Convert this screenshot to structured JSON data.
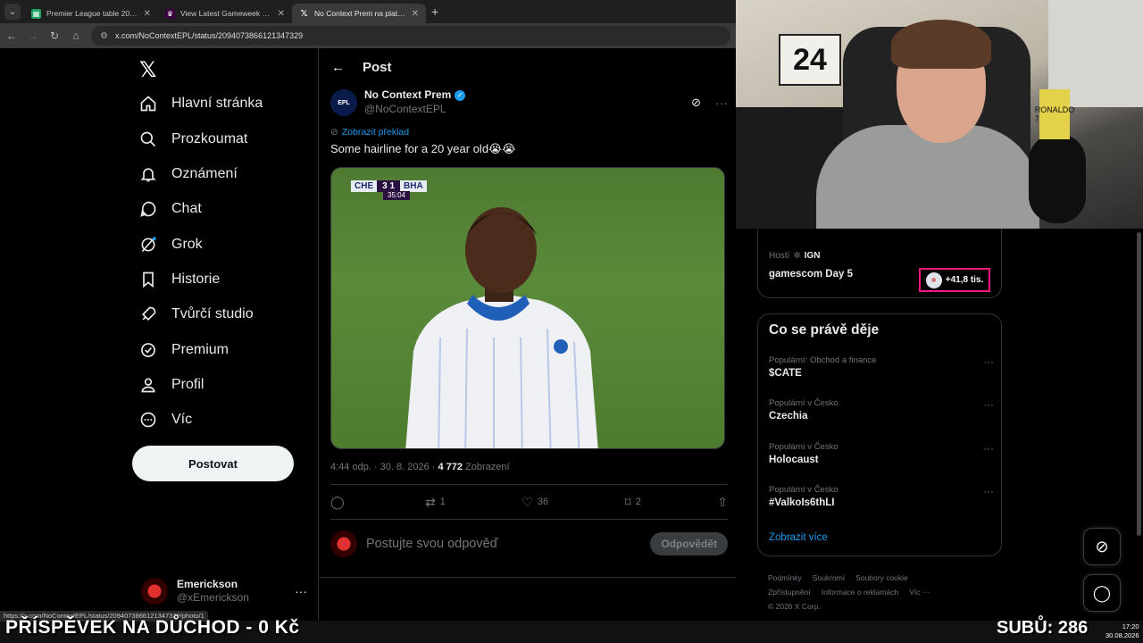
{
  "browser": {
    "tabs": [
      {
        "title": "Premier League table 2026/2027",
        "icon": "sheet-icon"
      },
      {
        "title": "View Latest Gameweek Points | Fantasy",
        "icon": "pl-icon"
      },
      {
        "title": "No Context Prem na platformě X",
        "icon": "x-icon"
      }
    ],
    "url": "x.com/NoContextEPL/status/2094073866121347329",
    "status_url": "https://x.com/NoContextEPL/status/2094073866121347329/photo/1"
  },
  "nav": {
    "items": [
      {
        "label": "Hlavní stránka",
        "icon": "home-icon"
      },
      {
        "label": "Prozkoumat",
        "icon": "search-icon"
      },
      {
        "label": "Oznámení",
        "icon": "bell-icon"
      },
      {
        "label": "Chat",
        "icon": "chat-icon"
      },
      {
        "label": "Grok",
        "icon": "grok-icon"
      },
      {
        "label": "Historie",
        "icon": "bookmark-icon"
      },
      {
        "label": "Tvůrčí studio",
        "icon": "rocket-icon"
      },
      {
        "label": "Premium",
        "icon": "premium-icon"
      },
      {
        "label": "Profil",
        "icon": "person-icon"
      },
      {
        "label": "Víc",
        "icon": "more-circle-icon"
      }
    ],
    "post_button": "Postovat",
    "account": {
      "display_name": "Emerickson",
      "handle": "@xEmerickson"
    }
  },
  "post": {
    "header_title": "Post",
    "author": {
      "display_name": "No Context Prem",
      "handle": "@NoContextEPL",
      "avatar_text": "EPL"
    },
    "translate_label": "Zobrazit překlad",
    "text": "Some hairline for a 20 year old😭😭",
    "media": {
      "home": "CHE",
      "score": "3 1",
      "away": "BHA",
      "clock": "35:04"
    },
    "time": "4:44 odp. · 30. 8. 2026 · ",
    "views_count": "4 772",
    "views_label": " Zobrazení",
    "actions": {
      "replies": "",
      "reposts": "1",
      "likes": "36",
      "bookmarks": "2"
    },
    "reply_placeholder": "Postujte svou odpověď",
    "reply_button": "Odpovědět"
  },
  "sidebar": {
    "live": {
      "host_label": "Hostí",
      "host_name": "IGN",
      "event": "gamescom Day 5",
      "listeners": "+41,8 tis."
    },
    "trends_title": "Co se právě děje",
    "trends": [
      {
        "category": "Populární: Obchod a finance",
        "name": "$CATE"
      },
      {
        "category": "Populární v Česko",
        "name": "Czechia"
      },
      {
        "category": "Populární v Česko",
        "name": "Holocaust"
      },
      {
        "category": "Populární v Česko",
        "name": "#ValkoIs6thLI"
      }
    ],
    "show_more": "Zobrazit více",
    "footer": [
      "Podmínky",
      "Soukromí",
      "Soubory cookie",
      "Zpřístupnění",
      "Informace o reklamách",
      "Víc ···",
      "© 2026 X Corp."
    ]
  },
  "overlay": {
    "banner": "PŘÍSPĚVEK NA DŮCHOD -  0 Kč",
    "subs": "SUBŮ: 286",
    "time": "17:20",
    "date": "30.08.2026",
    "jersey": "RONALDO 7",
    "frame_number": "24"
  }
}
